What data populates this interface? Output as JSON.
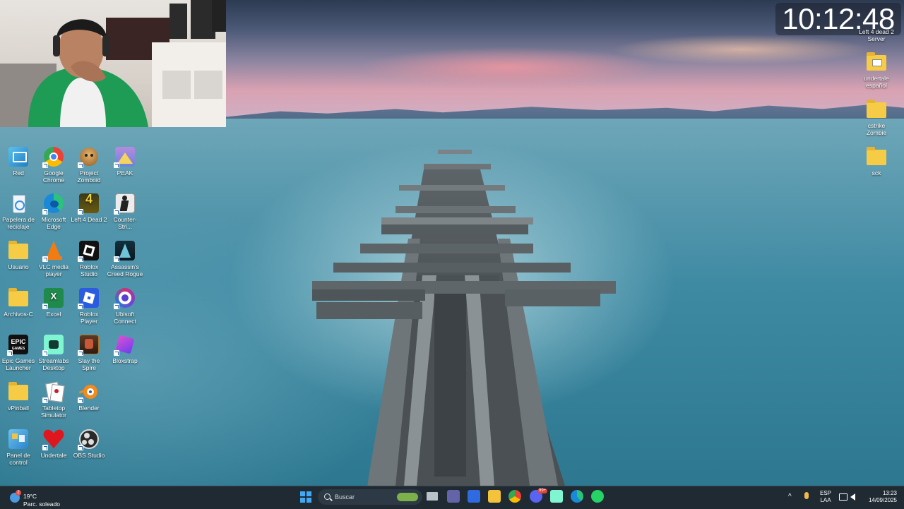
{
  "clock_overlay": {
    "time": "10:12:48"
  },
  "desktop_icons": {
    "red": "Red",
    "chrome": "Google Chrome",
    "zomboid": "Project Zomboid",
    "peak": "PEAK",
    "recycle": "Papelera de reciclaje",
    "edge": "Microsoft Edge",
    "l4d2": "Left 4 Dead 2",
    "counter": "Counter-Stri...",
    "usuario": "Usuario",
    "vlc": "VLC media player",
    "roblox_studio": "Roblox Studio",
    "assassins": "Assassin's Creed Rogue",
    "archivos": "Archivos-C",
    "excel": "Excel",
    "roblox_player": "Roblox Player",
    "ubisoft": "Ubisoft Connect",
    "epic": "Epic Games Launcher",
    "streamlabs": "Streamlabs Desktop",
    "slay": "Slay the Spire",
    "bloxstrap": "Bloxstrap",
    "vpinball": "vPinball",
    "tabletop": "Tabletop Simulator",
    "blender": "Blender",
    "panel": "Panel de control",
    "undertale": "Undertale",
    "obs": "OBS Studio",
    "l4d2_server": "Left 4 dead 2 Server",
    "undertale_es": "undertale español",
    "cstrike": "cstrike Zombie",
    "sck": "sck"
  },
  "icon_glyphs": {
    "epic": "EPIC",
    "epic_sub": "GAMES",
    "l4d2": "4",
    "excel": "X"
  },
  "taskbar": {
    "weather_temp": "19°C",
    "weather_desc": "Parc. soleado",
    "weather_badge": "2",
    "search_placeholder": "Buscar",
    "lang_top": "ESP",
    "lang_bottom": "LAA",
    "time": "13:23",
    "date": "14/09/2025",
    "discord_badge": "99+"
  },
  "colors": {
    "taskbar_bg": "#1f2a33",
    "start_blue": "#3fa9f5",
    "folder_yellow": "#f6cc47"
  }
}
